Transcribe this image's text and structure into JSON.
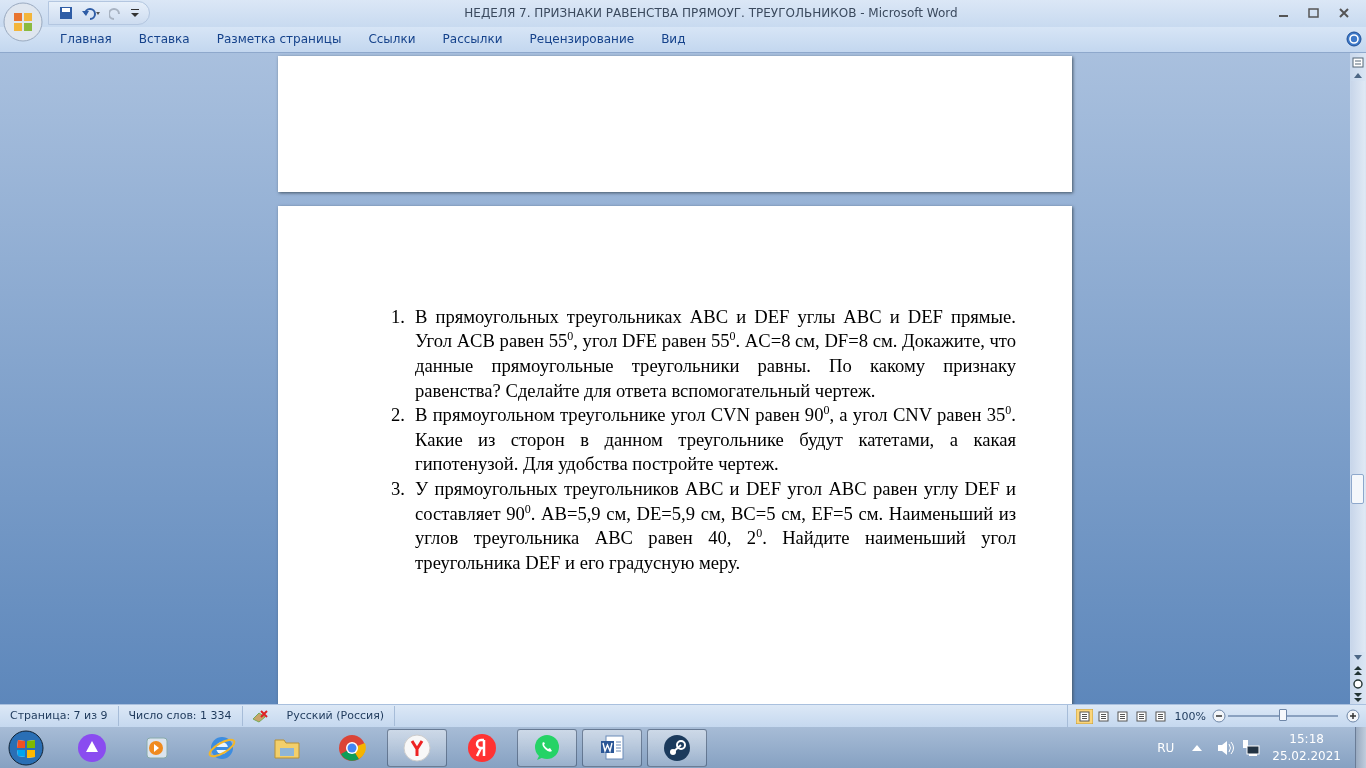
{
  "window": {
    "title": "НЕДЕЛЯ 7. ПРИЗНАКИ РАВЕНСТВА ПРЯМОУГ. ТРЕУГОЛЬНИКОВ - Microsoft Word"
  },
  "ribbon_tabs": [
    "Главная",
    "Вставка",
    "Разметка страницы",
    "Ссылки",
    "Рассылки",
    "Рецензирование",
    "Вид"
  ],
  "document": {
    "items": [
      {
        "number": "1.",
        "text": "В прямоугольных треугольниках ABC и DEF углы ABC и DEF прямые. Угол ACB равен 55$^{0}$, угол DFE равен 55$^{0}$. AC=8 см, DF=8 см. Докажите, что данные прямоугольные треугольники равны. По какому признаку равенства? Сделайте для ответа вспомогательный чертеж."
      },
      {
        "number": "2.",
        "text": "В прямоугольном треугольнике угол CVN равен 90$^{0}$, а угол CNV равен 35$^{0}$. Какие из сторон в данном треугольнике будут катетами,  а какая гипотенузой.  Для удобства постройте чертеж."
      },
      {
        "number": "3.",
        "text": "У прямоугольных треугольников ABC и DEF угол ABC равен углу DEF и составляет 90$^{0}$. AB=5,9 см, DE=5,9 см, BC=5 см, EF=5 см. Наименьший из углов треугольника ABC равен 40, 2$^{0}$. Найдите наименьший угол треугольника DEF и его градусную меру."
      }
    ]
  },
  "status_bar": {
    "page": "Страница: 7 из 9",
    "words": "Число слов: 1 334",
    "language": "Русский (Россия)",
    "zoom": "100%",
    "zoom_level": {
      "level": 0.5
    }
  },
  "taskbar": {
    "apps": [
      {
        "kind": "assistant",
        "running": false
      },
      {
        "kind": "media",
        "running": false
      },
      {
        "kind": "ie",
        "running": false
      },
      {
        "kind": "folder",
        "running": false
      },
      {
        "kind": "chrome",
        "running": false
      },
      {
        "kind": "ybrowser",
        "running": true
      },
      {
        "kind": "yandex",
        "running": false
      },
      {
        "kind": "whatsapp",
        "running": true
      },
      {
        "kind": "word",
        "running": true
      },
      {
        "kind": "steam",
        "running": true
      }
    ],
    "language": "RU",
    "time": "15:18",
    "date": "25.02.2021"
  }
}
